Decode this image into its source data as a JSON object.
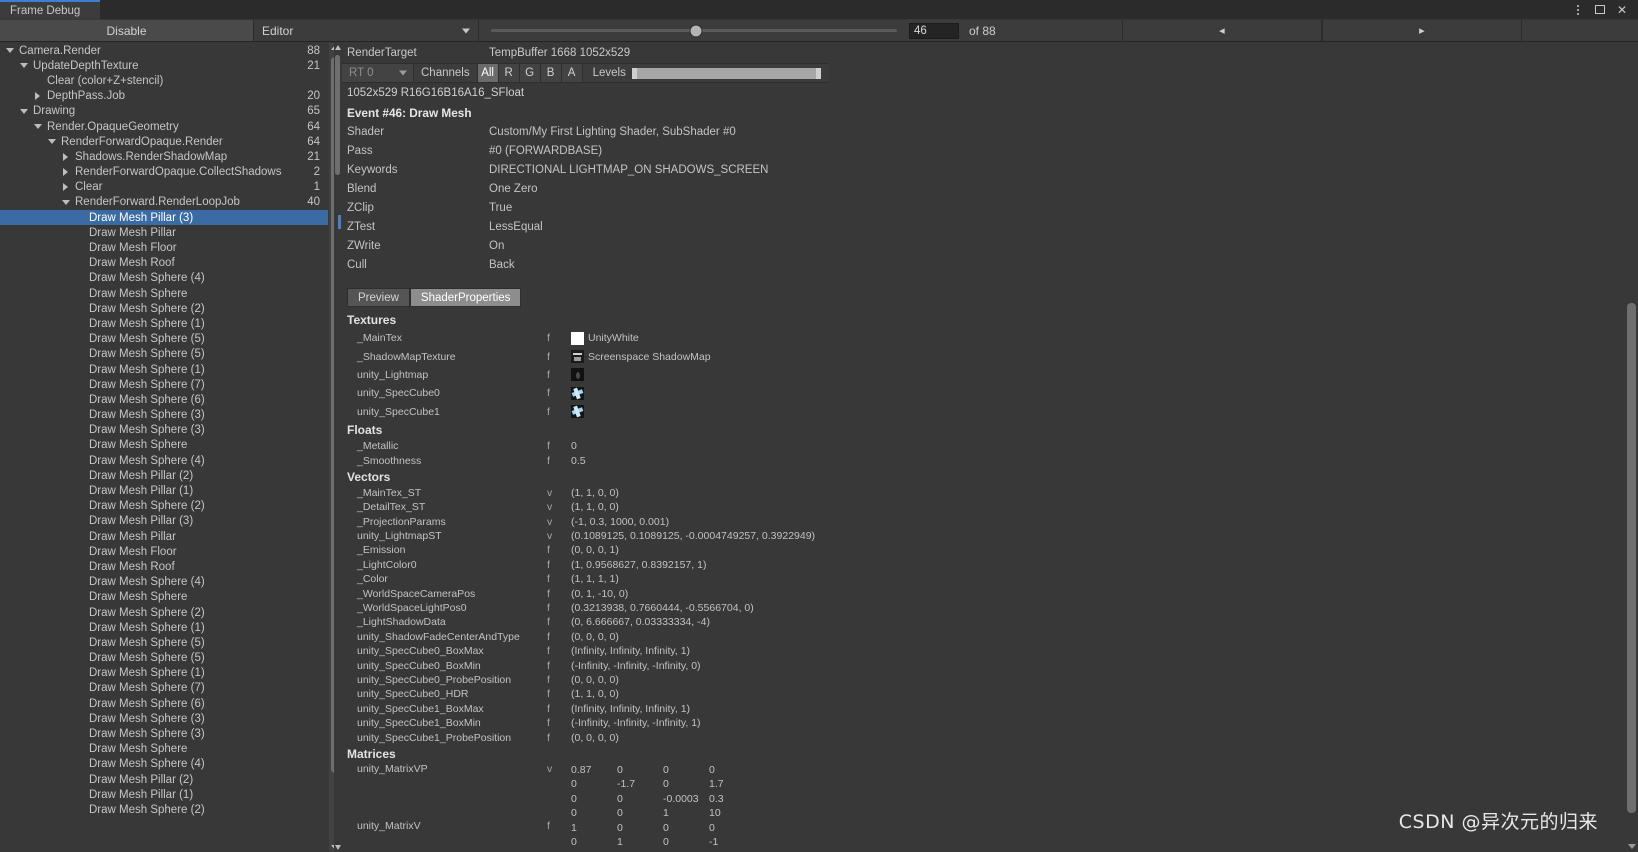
{
  "window": {
    "tab_title": "Frame Debug",
    "menu_icon": "kebab-menu-icon",
    "maximize_icon": "maximize-icon",
    "close_icon": "close-icon"
  },
  "toolbar": {
    "disable_label": "Disable",
    "context_value": "Editor",
    "event_index": "46",
    "event_total_label": "of 88",
    "prev_label": "◂",
    "next_label": "▸"
  },
  "tree": {
    "rows": [
      {
        "label": "Camera.Render",
        "count": "88",
        "indent": 0,
        "toggle": "down"
      },
      {
        "label": "UpdateDepthTexture",
        "count": "21",
        "indent": 1,
        "toggle": "down"
      },
      {
        "label": "Clear (color+Z+stencil)",
        "count": "",
        "indent": 2,
        "toggle": "none"
      },
      {
        "label": "DepthPass.Job",
        "count": "20",
        "indent": 2,
        "toggle": "right"
      },
      {
        "label": "Drawing",
        "count": "65",
        "indent": 1,
        "toggle": "down"
      },
      {
        "label": "Render.OpaqueGeometry",
        "count": "64",
        "indent": 2,
        "toggle": "down"
      },
      {
        "label": "RenderForwardOpaque.Render",
        "count": "64",
        "indent": 3,
        "toggle": "down"
      },
      {
        "label": "Shadows.RenderShadowMap",
        "count": "21",
        "indent": 4,
        "toggle": "right"
      },
      {
        "label": "RenderForwardOpaque.CollectShadows",
        "count": "2",
        "indent": 4,
        "toggle": "right"
      },
      {
        "label": "Clear",
        "count": "1",
        "indent": 4,
        "toggle": "right"
      },
      {
        "label": "RenderForward.RenderLoopJob",
        "count": "40",
        "indent": 4,
        "toggle": "down"
      },
      {
        "label": "Draw Mesh Pillar (3)",
        "count": "",
        "indent": 5,
        "toggle": "none",
        "selected": true
      },
      {
        "label": "Draw Mesh Pillar",
        "count": "",
        "indent": 5,
        "toggle": "none"
      },
      {
        "label": "Draw Mesh Floor",
        "count": "",
        "indent": 5,
        "toggle": "none"
      },
      {
        "label": "Draw Mesh Roof",
        "count": "",
        "indent": 5,
        "toggle": "none"
      },
      {
        "label": "Draw Mesh Sphere (4)",
        "count": "",
        "indent": 5,
        "toggle": "none"
      },
      {
        "label": "Draw Mesh Sphere",
        "count": "",
        "indent": 5,
        "toggle": "none"
      },
      {
        "label": "Draw Mesh Sphere (2)",
        "count": "",
        "indent": 5,
        "toggle": "none"
      },
      {
        "label": "Draw Mesh Sphere (1)",
        "count": "",
        "indent": 5,
        "toggle": "none"
      },
      {
        "label": "Draw Mesh Sphere (5)",
        "count": "",
        "indent": 5,
        "toggle": "none"
      },
      {
        "label": "Draw Mesh Sphere (5)",
        "count": "",
        "indent": 5,
        "toggle": "none"
      },
      {
        "label": "Draw Mesh Sphere (1)",
        "count": "",
        "indent": 5,
        "toggle": "none"
      },
      {
        "label": "Draw Mesh Sphere (7)",
        "count": "",
        "indent": 5,
        "toggle": "none"
      },
      {
        "label": "Draw Mesh Sphere (6)",
        "count": "",
        "indent": 5,
        "toggle": "none"
      },
      {
        "label": "Draw Mesh Sphere (3)",
        "count": "",
        "indent": 5,
        "toggle": "none"
      },
      {
        "label": "Draw Mesh Sphere (3)",
        "count": "",
        "indent": 5,
        "toggle": "none"
      },
      {
        "label": "Draw Mesh Sphere",
        "count": "",
        "indent": 5,
        "toggle": "none"
      },
      {
        "label": "Draw Mesh Sphere (4)",
        "count": "",
        "indent": 5,
        "toggle": "none"
      },
      {
        "label": "Draw Mesh Pillar (2)",
        "count": "",
        "indent": 5,
        "toggle": "none"
      },
      {
        "label": "Draw Mesh Pillar (1)",
        "count": "",
        "indent": 5,
        "toggle": "none"
      },
      {
        "label": "Draw Mesh Sphere (2)",
        "count": "",
        "indent": 5,
        "toggle": "none"
      },
      {
        "label": "Draw Mesh Pillar (3)",
        "count": "",
        "indent": 5,
        "toggle": "none"
      },
      {
        "label": "Draw Mesh Pillar",
        "count": "",
        "indent": 5,
        "toggle": "none"
      },
      {
        "label": "Draw Mesh Floor",
        "count": "",
        "indent": 5,
        "toggle": "none"
      },
      {
        "label": "Draw Mesh Roof",
        "count": "",
        "indent": 5,
        "toggle": "none"
      },
      {
        "label": "Draw Mesh Sphere (4)",
        "count": "",
        "indent": 5,
        "toggle": "none"
      },
      {
        "label": "Draw Mesh Sphere",
        "count": "",
        "indent": 5,
        "toggle": "none"
      },
      {
        "label": "Draw Mesh Sphere (2)",
        "count": "",
        "indent": 5,
        "toggle": "none"
      },
      {
        "label": "Draw Mesh Sphere (1)",
        "count": "",
        "indent": 5,
        "toggle": "none"
      },
      {
        "label": "Draw Mesh Sphere (5)",
        "count": "",
        "indent": 5,
        "toggle": "none"
      },
      {
        "label": "Draw Mesh Sphere (5)",
        "count": "",
        "indent": 5,
        "toggle": "none"
      },
      {
        "label": "Draw Mesh Sphere (1)",
        "count": "",
        "indent": 5,
        "toggle": "none"
      },
      {
        "label": "Draw Mesh Sphere (7)",
        "count": "",
        "indent": 5,
        "toggle": "none"
      },
      {
        "label": "Draw Mesh Sphere (6)",
        "count": "",
        "indent": 5,
        "toggle": "none"
      },
      {
        "label": "Draw Mesh Sphere (3)",
        "count": "",
        "indent": 5,
        "toggle": "none"
      },
      {
        "label": "Draw Mesh Sphere (3)",
        "count": "",
        "indent": 5,
        "toggle": "none"
      },
      {
        "label": "Draw Mesh Sphere",
        "count": "",
        "indent": 5,
        "toggle": "none"
      },
      {
        "label": "Draw Mesh Sphere (4)",
        "count": "",
        "indent": 5,
        "toggle": "none"
      },
      {
        "label": "Draw Mesh Pillar (2)",
        "count": "",
        "indent": 5,
        "toggle": "none"
      },
      {
        "label": "Draw Mesh Pillar (1)",
        "count": "",
        "indent": 5,
        "toggle": "none"
      },
      {
        "label": "Draw Mesh Sphere (2)",
        "count": "",
        "indent": 5,
        "toggle": "none"
      }
    ]
  },
  "rendertarget": {
    "label": "RenderTarget",
    "value": "TempBuffer 1668 1052x529",
    "rt_select": "RT 0",
    "channels_label": "Channels",
    "channels": [
      "All",
      "R",
      "G",
      "B",
      "A"
    ],
    "channel_active": "All",
    "levels_label": "Levels",
    "format_line": "1052x529 R16G16B16A16_SFloat"
  },
  "event": {
    "title": "Event #46: Draw Mesh",
    "properties": [
      {
        "key": "Shader",
        "value": "Custom/My First Lighting Shader, SubShader #0"
      },
      {
        "key": "Pass",
        "value": "#0 (FORWARDBASE)"
      },
      {
        "key": "Keywords",
        "value": "DIRECTIONAL LIGHTMAP_ON SHADOWS_SCREEN"
      },
      {
        "key": "Blend",
        "value": "One Zero"
      },
      {
        "key": "ZClip",
        "value": "True"
      },
      {
        "key": "ZTest",
        "value": "LessEqual"
      },
      {
        "key": "ZWrite",
        "value": "On"
      },
      {
        "key": "Cull",
        "value": "Back"
      }
    ]
  },
  "detail_tabs": {
    "preview": "Preview",
    "shader_properties": "ShaderProperties",
    "active": "ShaderProperties"
  },
  "shader_properties": {
    "textures_header": "Textures",
    "textures": [
      {
        "name": "_MainTex",
        "type": "f",
        "value": "UnityWhite",
        "swatch": "sw-white"
      },
      {
        "name": "_ShadowMapTexture",
        "type": "f",
        "value": "Screenspace ShadowMap",
        "swatch": "sw-shadow"
      },
      {
        "name": "unity_Lightmap",
        "type": "f",
        "value": "",
        "swatch": "sw-lightmap"
      },
      {
        "name": "unity_SpecCube0",
        "type": "f",
        "value": "",
        "swatch": "sw-cube"
      },
      {
        "name": "unity_SpecCube1",
        "type": "f",
        "value": "",
        "swatch": "sw-cube"
      }
    ],
    "floats_header": "Floats",
    "floats": [
      {
        "name": "_Metallic",
        "type": "f",
        "value": "0"
      },
      {
        "name": "_Smoothness",
        "type": "f",
        "value": "0.5"
      }
    ],
    "vectors_header": "Vectors",
    "vectors": [
      {
        "name": "_MainTex_ST",
        "type": "v",
        "value": "(1, 1, 0, 0)"
      },
      {
        "name": "_DetailTex_ST",
        "type": "v",
        "value": "(1, 1, 0, 0)"
      },
      {
        "name": "_ProjectionParams",
        "type": "v",
        "value": "(-1, 0.3, 1000, 0.001)"
      },
      {
        "name": "unity_LightmapST",
        "type": "v",
        "value": "(0.1089125, 0.1089125, -0.0004749257, 0.3922949)"
      },
      {
        "name": "_Emission",
        "type": "f",
        "value": "(0, 0, 0, 1)"
      },
      {
        "name": "_LightColor0",
        "type": "f",
        "value": "(1, 0.9568627, 0.8392157, 1)"
      },
      {
        "name": "_Color",
        "type": "f",
        "value": "(1, 1, 1, 1)"
      },
      {
        "name": "_WorldSpaceCameraPos",
        "type": "f",
        "value": "(0, 1, -10, 0)"
      },
      {
        "name": "_WorldSpaceLightPos0",
        "type": "f",
        "value": "(0.3213938, 0.7660444, -0.5566704, 0)"
      },
      {
        "name": "_LightShadowData",
        "type": "f",
        "value": "(0, 6.666667, 0.03333334, -4)"
      },
      {
        "name": "unity_ShadowFadeCenterAndType",
        "type": "f",
        "value": "(0, 0, 0, 0)"
      },
      {
        "name": "unity_SpecCube0_BoxMax",
        "type": "f",
        "value": "(Infinity, Infinity, Infinity, 1)"
      },
      {
        "name": "unity_SpecCube0_BoxMin",
        "type": "f",
        "value": "(-Infinity, -Infinity, -Infinity, 0)"
      },
      {
        "name": "unity_SpecCube0_ProbePosition",
        "type": "f",
        "value": "(0, 0, 0, 0)"
      },
      {
        "name": "unity_SpecCube0_HDR",
        "type": "f",
        "value": "(1, 1, 0, 0)"
      },
      {
        "name": "unity_SpecCube1_BoxMax",
        "type": "f",
        "value": "(Infinity, Infinity, Infinity, 1)"
      },
      {
        "name": "unity_SpecCube1_BoxMin",
        "type": "f",
        "value": "(-Infinity, -Infinity, -Infinity, 1)"
      },
      {
        "name": "unity_SpecCube1_ProbePosition",
        "type": "f",
        "value": "(0, 0, 0, 0)"
      }
    ],
    "matrices_header": "Matrices",
    "matrices": [
      {
        "name": "unity_MatrixVP",
        "type": "v",
        "rows": [
          [
            "0.87",
            "0",
            "0",
            "0"
          ],
          [
            "0",
            "-1.7",
            "0",
            "1.7"
          ],
          [
            "0",
            "0",
            "-0.0003",
            "0.3"
          ],
          [
            "0",
            "0",
            "1",
            "10"
          ]
        ]
      },
      {
        "name": "unity_MatrixV",
        "type": "f",
        "rows": [
          [
            "1",
            "0",
            "0",
            "0"
          ],
          [
            "0",
            "1",
            "0",
            "-1"
          ]
        ]
      }
    ]
  },
  "watermark": {
    "text": "CSDN @异次元的归来"
  }
}
